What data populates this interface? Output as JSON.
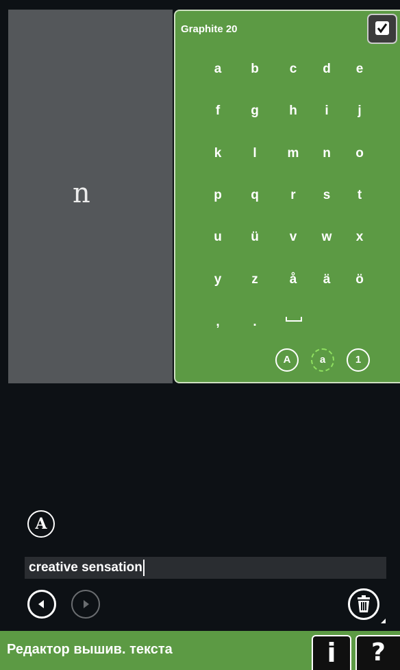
{
  "preview": {
    "glyph": "n"
  },
  "keyboard": {
    "font_name": "Graphite 20",
    "keys": [
      [
        "a",
        "b",
        "c",
        "d",
        "e"
      ],
      [
        "f",
        "g",
        "h",
        "i",
        "j"
      ],
      [
        "k",
        "l",
        "m",
        "n",
        "o"
      ],
      [
        "p",
        "q",
        "r",
        "s",
        "t"
      ],
      [
        "u",
        "ü",
        "v",
        "w",
        "x"
      ],
      [
        "y",
        "z",
        "å",
        "ä",
        "ö"
      ],
      [
        ",",
        ".",
        "space"
      ]
    ],
    "case_buttons": {
      "upper": "A",
      "lower": "a",
      "numbers": "1"
    },
    "selected_case": "lower"
  },
  "editor": {
    "font_style_label": "A",
    "text_value": "creative sensation"
  },
  "icons": {
    "confirm": "checkmark-icon",
    "prev": "arrow-left-icon",
    "next": "arrow-right-icon",
    "delete": "trash-icon"
  },
  "footer": {
    "title": "Редактор вышив. текста",
    "info_label": "i",
    "help_label": "?"
  },
  "colors": {
    "panel_green": "#5c9a44",
    "background": "#0d1115",
    "preview_gray": "#54575a"
  }
}
